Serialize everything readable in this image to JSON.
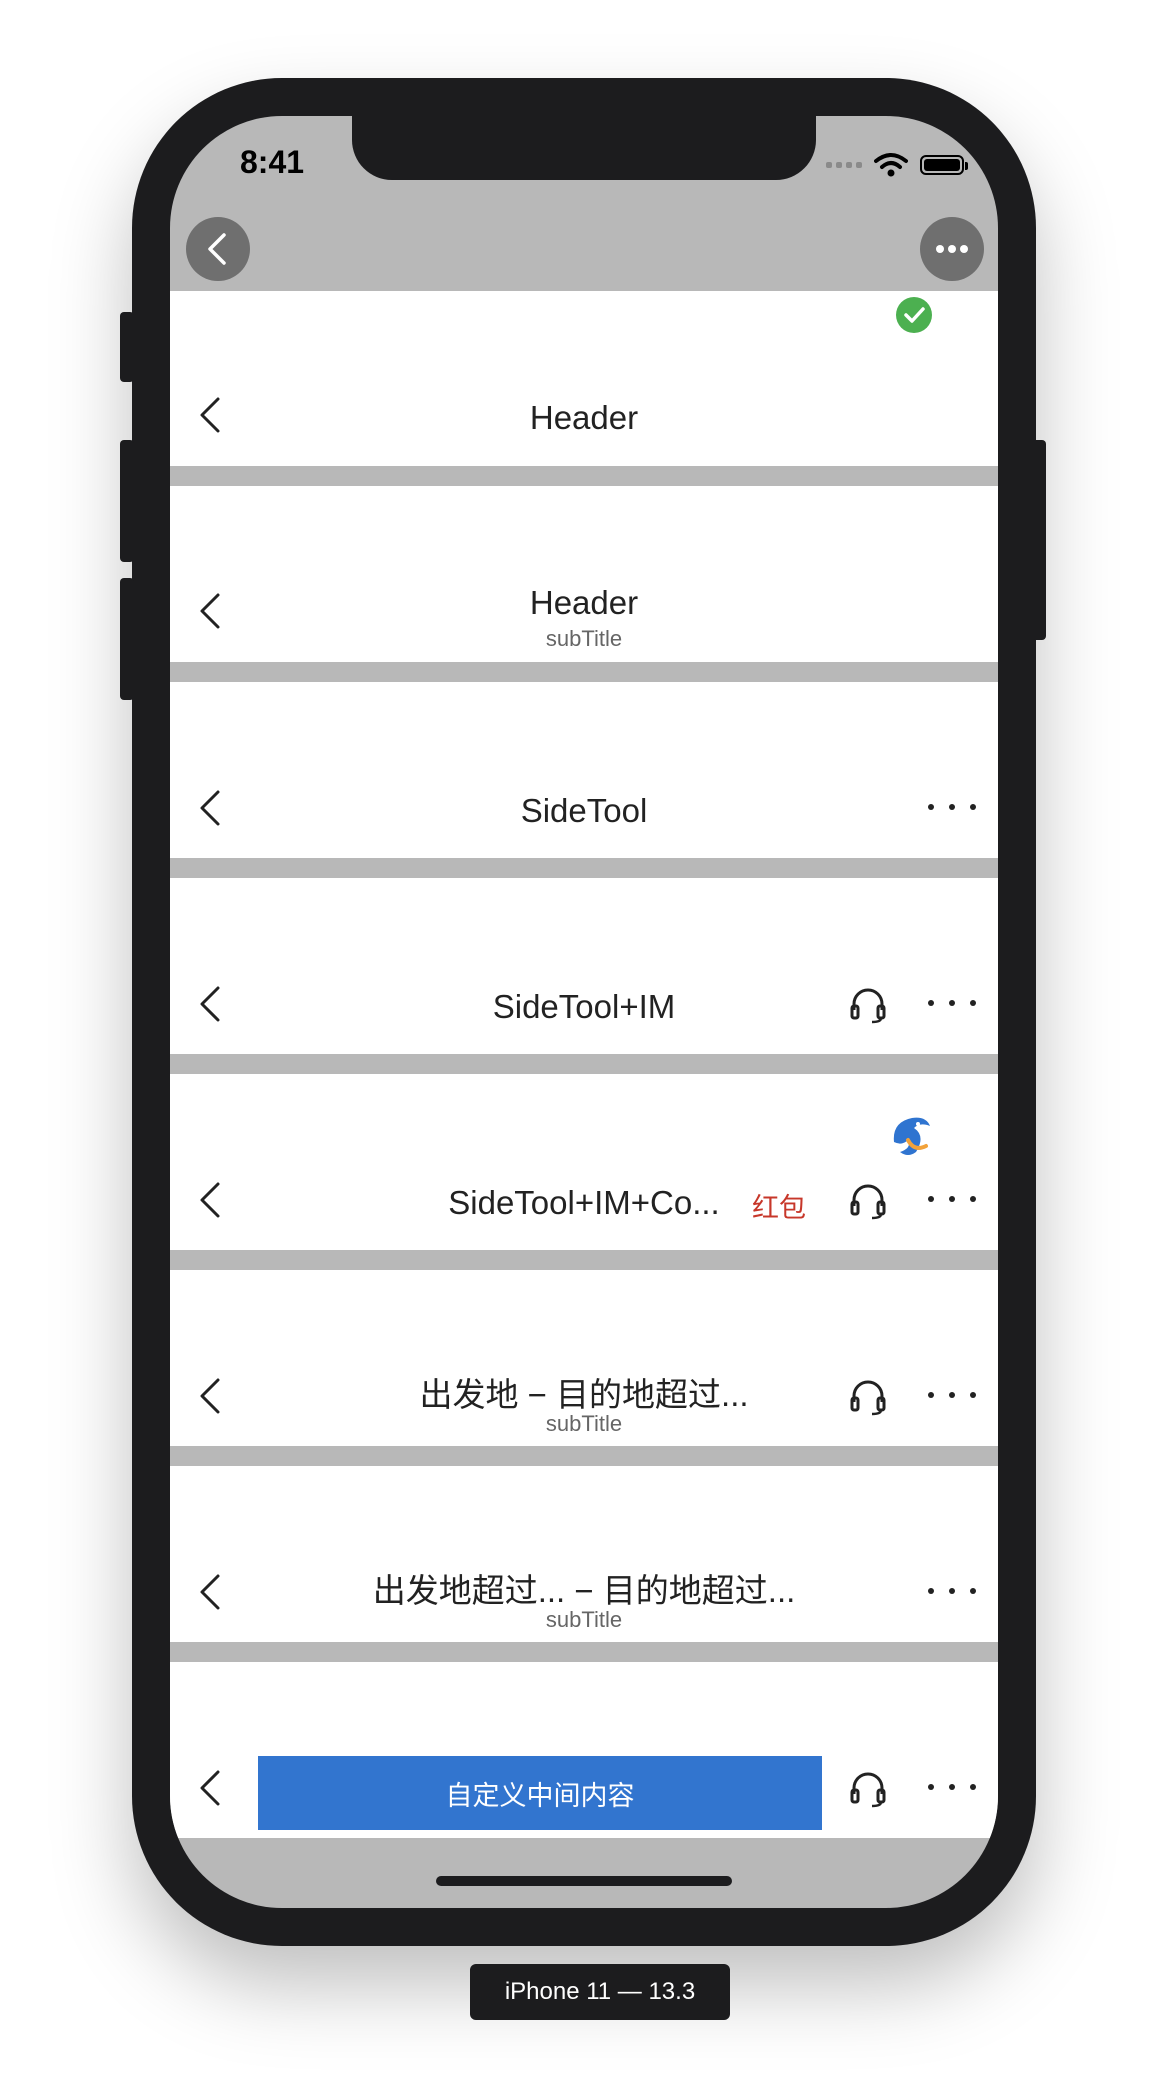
{
  "status_bar": {
    "time": "8:41"
  },
  "rows": [
    {
      "title": "Header"
    },
    {
      "title": "Header",
      "subtitle": "subTitle"
    },
    {
      "title": "SideTool"
    },
    {
      "title": "SideTool+IM"
    },
    {
      "title": "SideTool+IM+Co...",
      "redpack": "红包"
    },
    {
      "title": "出发地 − 目的地超过...",
      "subtitle": "subTitle"
    },
    {
      "title": "出发地超过... − 目的地超过...",
      "subtitle": "subTitle"
    },
    {
      "custom_center": "自定义中间内容"
    }
  ],
  "device_label": "iPhone 11 — 13.3",
  "colors": {
    "accent_blue": "#3275cf",
    "red": "#c7372a",
    "check_green": "#4cb050",
    "gray_bar": "#b8b8b8"
  }
}
